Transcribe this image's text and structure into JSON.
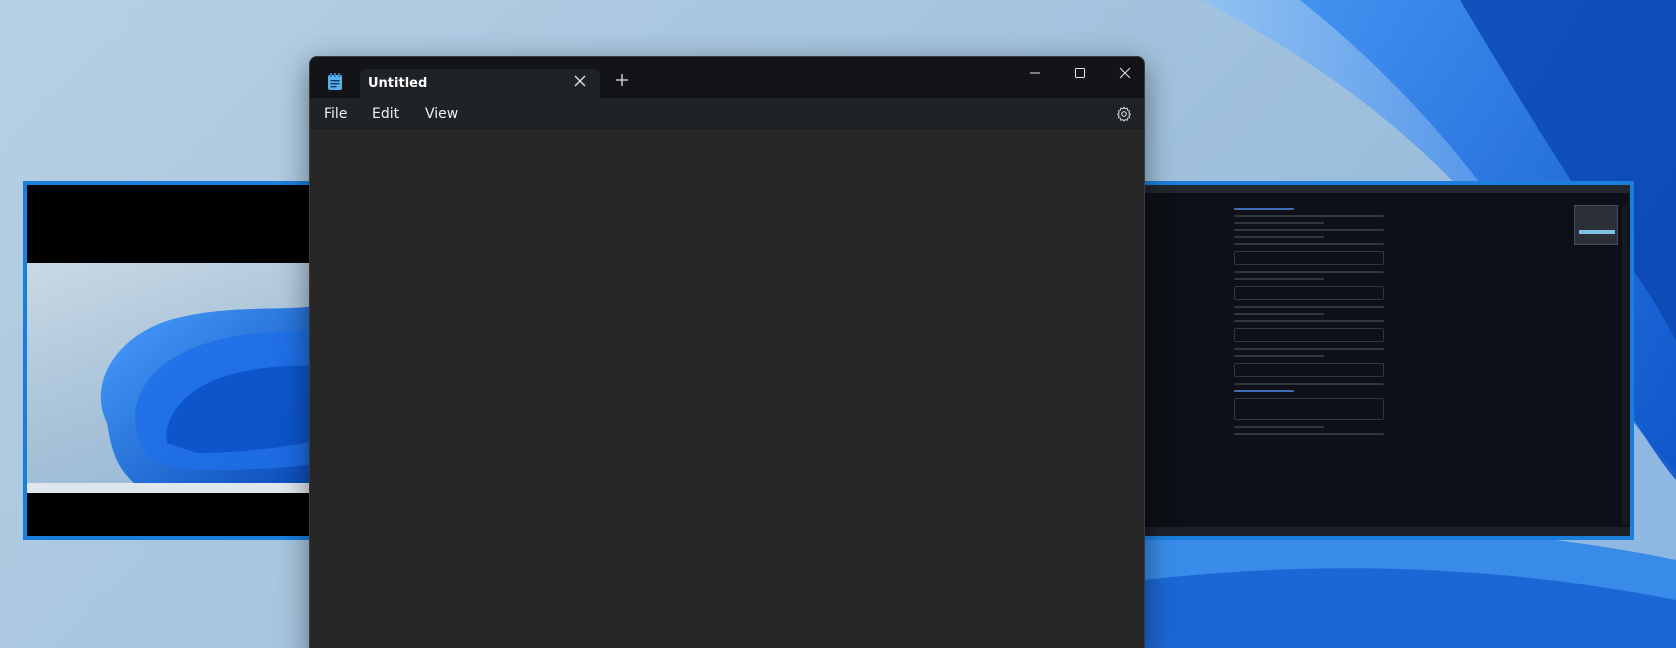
{
  "desktop": {
    "background_color": "#a8c6df",
    "accent_blue": "#1a7fdc"
  },
  "notepad": {
    "tab_title": "Untitled",
    "menu": {
      "file": "File",
      "edit": "Edit",
      "view": "View"
    },
    "editor_text": "",
    "icons": {
      "app": "notepad-icon",
      "tab_close": "close-icon",
      "new_tab": "plus-icon",
      "minimize": "minimize-icon",
      "maximize": "maximize-icon",
      "close": "close-icon",
      "settings": "gear-icon"
    }
  }
}
